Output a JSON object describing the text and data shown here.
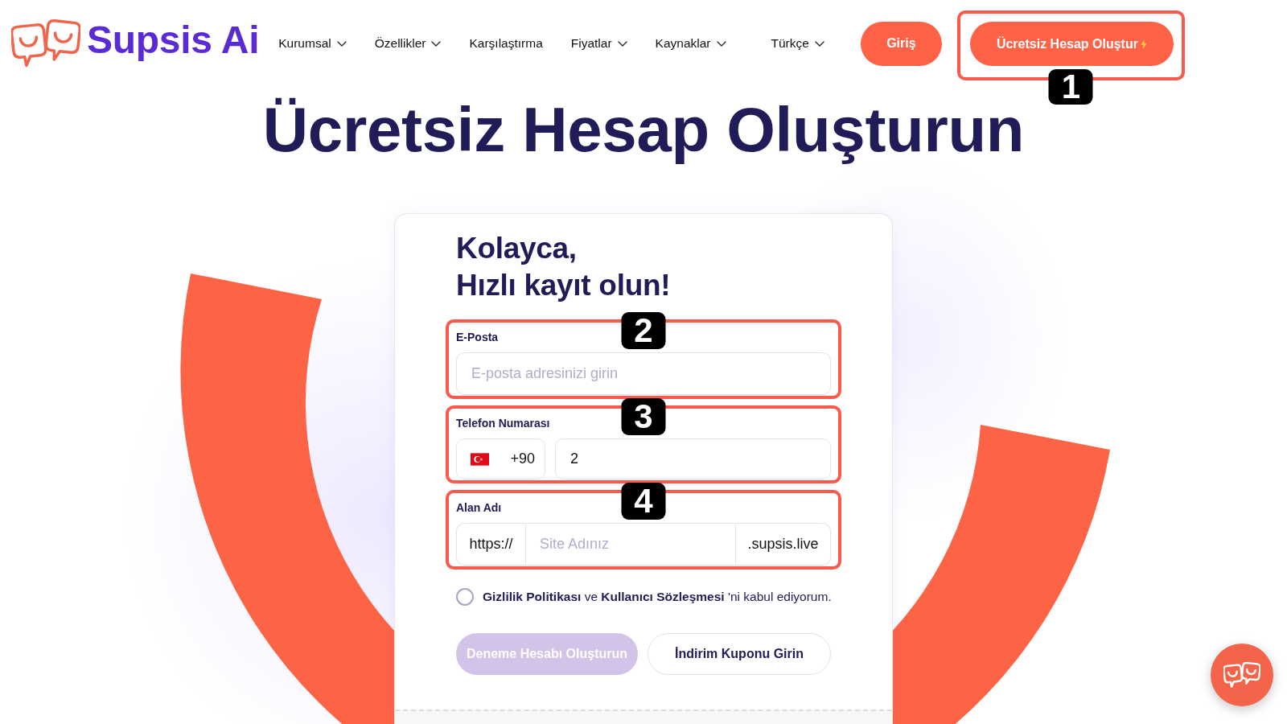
{
  "header": {
    "logo": {
      "text": "Supsis Ai"
    },
    "nav": [
      {
        "label": "Kurumsal",
        "has_dropdown": true
      },
      {
        "label": "Özellikler",
        "has_dropdown": true
      },
      {
        "label": "Karşılaştırma",
        "has_dropdown": false
      },
      {
        "label": "Fiyatlar",
        "has_dropdown": true
      },
      {
        "label": "Kaynaklar",
        "has_dropdown": true
      }
    ],
    "language": {
      "label": "Türkçe",
      "has_dropdown": true
    },
    "login_button": {
      "label": "Giriş"
    },
    "signup_button": {
      "label": "Ücretsiz Hesap Oluştur",
      "callout": "1"
    }
  },
  "page_title": "Ücretsiz Hesap Oluşturun",
  "form": {
    "heading": "Kolayca,\nHızlı kayıt olun!",
    "email": {
      "label": "E-Posta",
      "placeholder": "E-posta adresinizi girin",
      "callout": "2"
    },
    "phone": {
      "label": "Telefon Numarası",
      "country_code": "+90",
      "value": "2",
      "callout": "3"
    },
    "domain": {
      "label": "Alan Adı",
      "prefix": "https://",
      "placeholder": "Site Adınız",
      "suffix": ".supsis.live",
      "callout": "4"
    },
    "consent": {
      "text": "**Gizlilik Politikası** ve **Kullanıcı Sözleşmesi** 'ni kabul ediyorum.",
      "checked": false
    },
    "buttons": [
      {
        "label": "Deneme Hesabı Oluşturun",
        "kind": "primary",
        "disabled": true
      },
      {
        "label": "İndirim Kuponu Girin",
        "kind": "outline",
        "disabled": false
      }
    ]
  }
}
